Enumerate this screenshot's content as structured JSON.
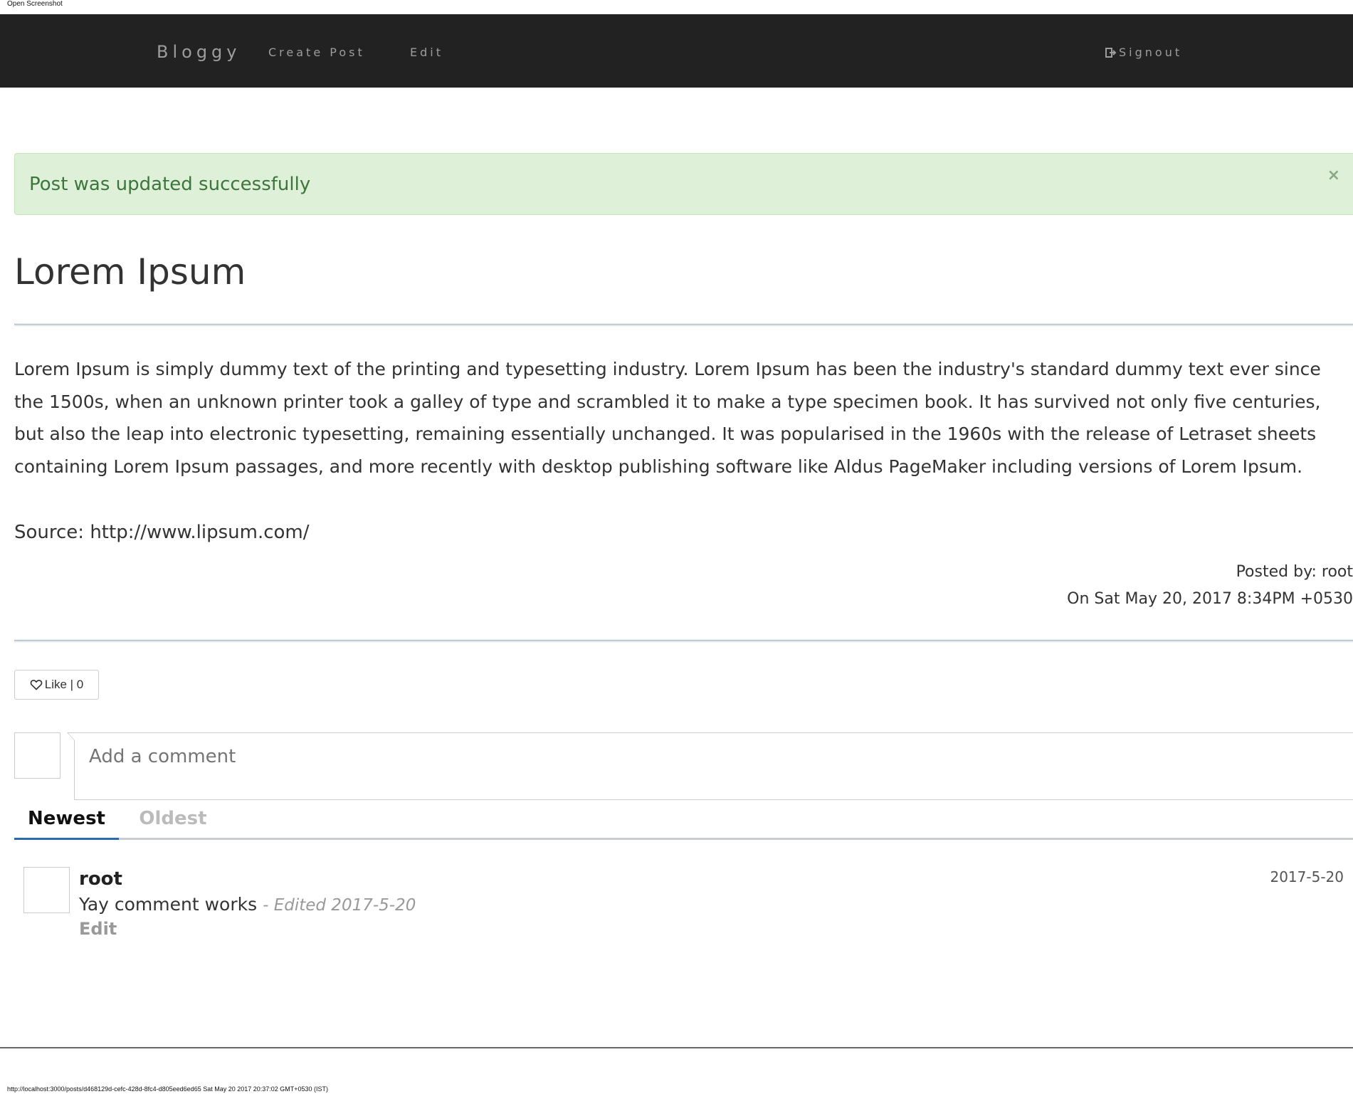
{
  "page": {
    "top_caption": "Open Screenshot",
    "bottom_caption": "http://localhost:3000/posts/d468129d-cefc-428d-8fc4-d805eed6ed65 Sat May 20 2017 20:37:02 GMT+0530 (IST)"
  },
  "navbar": {
    "brand": "Bloggy",
    "create_post": "Create Post",
    "edit": "Edit",
    "signout": "Signout",
    "signout_icon": "logout-icon",
    "background": "#222222"
  },
  "alert": {
    "message": "Post was updated successfully",
    "close_label": "×",
    "background": "#dff0d8",
    "text_color": "#3c763d"
  },
  "post": {
    "title": "Lorem Ipsum",
    "body": "Lorem Ipsum is simply dummy text of the printing and typesetting industry. Lorem Ipsum has been the industry's standard dummy text ever since the 1500s, when an unknown printer took a galley of type and scrambled it to make a type specimen book. It has survived not only five centuries, but also the leap into electronic typesetting, remaining essentially unchanged. It was popularised in the 1960s with the release of Letraset sheets containing Lorem Ipsum passages, and more recently with desktop publishing software like Aldus PageMaker including versions of Lorem Ipsum.",
    "source": "Source: http://www.lipsum.com/",
    "posted_by": "Posted by: root",
    "posted_on": "On Sat May 20, 2017 8:34PM +0530"
  },
  "like": {
    "label": "Like | 0",
    "icon": "heart-outline-icon"
  },
  "comments": {
    "placeholder": "Add a comment",
    "tabs": {
      "newest": "Newest",
      "oldest": "Oldest",
      "active": "Newest",
      "active_color": "#2d6aad"
    },
    "items": [
      {
        "author": "root",
        "date": "2017-5-20",
        "text": "Yay comment works",
        "edited": "- Edited 2017-5-20",
        "edit_label": "Edit"
      }
    ]
  }
}
